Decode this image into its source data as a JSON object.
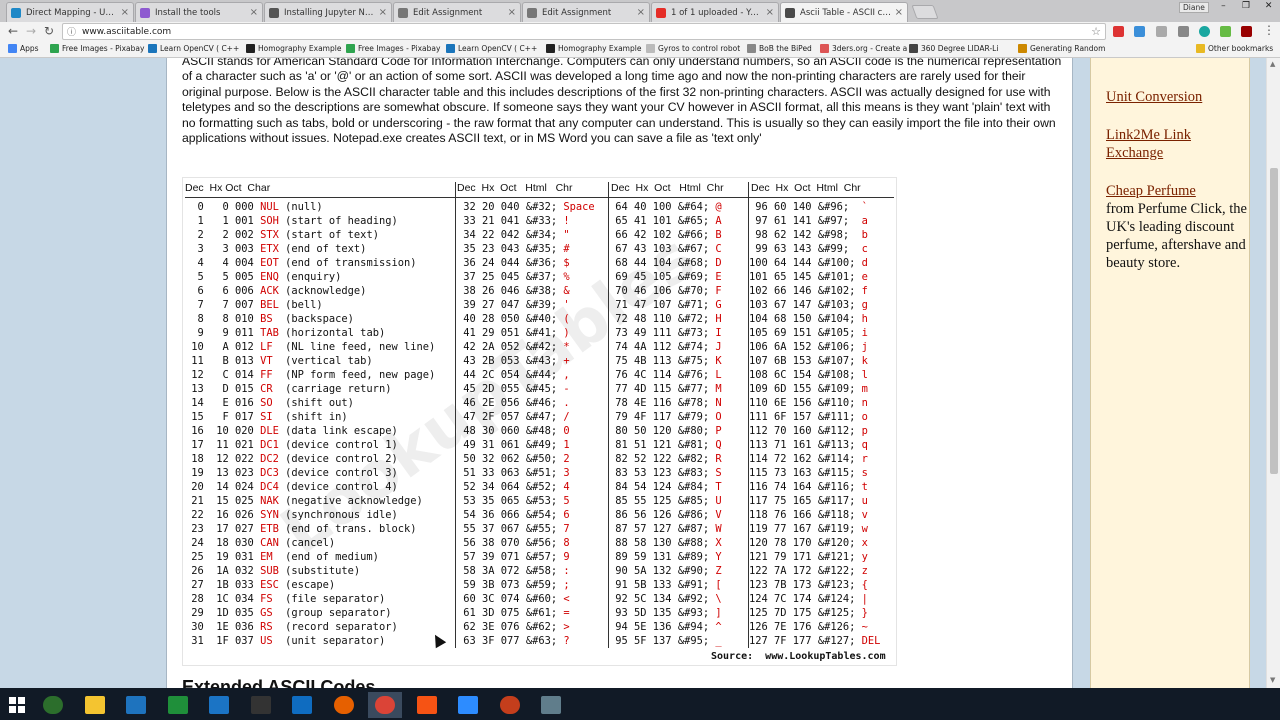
{
  "tabs": [
    {
      "title": "Direct Mapping - Udacity",
      "color": "#1e88c7"
    },
    {
      "title": "Install the tools",
      "color": "#8e5ad0"
    },
    {
      "title": "Installing Jupyter Notebook",
      "color": "#555555"
    },
    {
      "title": "Edit Assignment",
      "color": "#777777"
    },
    {
      "title": "Edit Assignment",
      "color": "#777777"
    },
    {
      "title": "1 of 1 uploaded - YouTube",
      "color": "#e52d27"
    },
    {
      "title": "Ascii Table - ASCII character",
      "color": "#4a4a4a",
      "active": true
    }
  ],
  "user_name": "Diane",
  "url": "www.asciitable.com",
  "bookmarks": [
    "Apps",
    "Free Images - Pixabay",
    "Learn OpenCV ( C++",
    "Homography Example",
    "Free Images - Pixabay",
    "Learn OpenCV ( C++",
    "Homography Example",
    "Gyros to control robot",
    "BoB the BiPed",
    "3ders.org - Create a 3",
    "360 Degree LIDAR-Li",
    "Generating Random",
    "Other bookmarks"
  ],
  "intro_text": "ASCII stands for American Standard Code for Information Interchange. Computers can only understand numbers, so an ASCII code is the numerical representation of a character such as 'a' or '@' or an action of some sort. ASCII was developed a long time ago and now the non-printing characters are rarely used for their original purpose. Below is the ASCII character table and this includes descriptions of the first 32 non-printing characters. ASCII was actually designed for use with teletypes and so the descriptions are somewhat obscure. If someone says they want your CV however in ASCII format, all this means is they want 'plain' text with no formatting such as tabs, bold or underscoring - the raw format that any computer can understand. This is usually so they can easily import the file into their own applications without issues. Notepad.exe creates ASCII text, or in MS Word you can save a file as 'text only'",
  "table": {
    "headers": [
      "Dec  Hx Oct  Char",
      "Dec  Hx  Oct   Html   Chr",
      "Dec  Hx  Oct   Html  Chr",
      "Dec  Hx  Oct  Html  Chr"
    ],
    "col1": [
      [
        "  0   0 000 ",
        "NUL",
        " (null)"
      ],
      [
        "  1   1 001 ",
        "SOH",
        " (start of heading)"
      ],
      [
        "  2   2 002 ",
        "STX",
        " (start of text)"
      ],
      [
        "  3   3 003 ",
        "ETX",
        " (end of text)"
      ],
      [
        "  4   4 004 ",
        "EOT",
        " (end of transmission)"
      ],
      [
        "  5   5 005 ",
        "ENQ",
        " (enquiry)"
      ],
      [
        "  6   6 006 ",
        "ACK",
        " (acknowledge)"
      ],
      [
        "  7   7 007 ",
        "BEL",
        " (bell)"
      ],
      [
        "  8   8 010 ",
        "BS",
        "  (backspace)"
      ],
      [
        "  9   9 011 ",
        "TAB",
        " (horizontal tab)"
      ],
      [
        " 10   A 012 ",
        "LF",
        "  (NL line feed, new line)"
      ],
      [
        " 11   B 013 ",
        "VT",
        "  (vertical tab)"
      ],
      [
        " 12   C 014 ",
        "FF",
        "  (NP form feed, new page)"
      ],
      [
        " 13   D 015 ",
        "CR",
        "  (carriage return)"
      ],
      [
        " 14   E 016 ",
        "SO",
        "  (shift out)"
      ],
      [
        " 15   F 017 ",
        "SI",
        "  (shift in)"
      ],
      [
        " 16  10 020 ",
        "DLE",
        " (data link escape)"
      ],
      [
        " 17  11 021 ",
        "DC1",
        " (device control 1)"
      ],
      [
        " 18  12 022 ",
        "DC2",
        " (device control 2)"
      ],
      [
        " 19  13 023 ",
        "DC3",
        " (device control 3)"
      ],
      [
        " 20  14 024 ",
        "DC4",
        " (device control 4)"
      ],
      [
        " 21  15 025 ",
        "NAK",
        " (negative acknowledge)"
      ],
      [
        " 22  16 026 ",
        "SYN",
        " (synchronous idle)"
      ],
      [
        " 23  17 027 ",
        "ETB",
        " (end of trans. block)"
      ],
      [
        " 24  18 030 ",
        "CAN",
        " (cancel)"
      ],
      [
        " 25  19 031 ",
        "EM",
        "  (end of medium)"
      ],
      [
        " 26  1A 032 ",
        "SUB",
        " (substitute)"
      ],
      [
        " 27  1B 033 ",
        "ESC",
        " (escape)"
      ],
      [
        " 28  1C 034 ",
        "FS",
        "  (file separator)"
      ],
      [
        " 29  1D 035 ",
        "GS",
        "  (group separator)"
      ],
      [
        " 30  1E 036 ",
        "RS",
        "  (record separator)"
      ],
      [
        " 31  1F 037 ",
        "US",
        "  (unit separator)"
      ]
    ],
    "col2": [
      [
        " 32 20 040 &#32; ",
        "Space"
      ],
      [
        " 33 21 041 &#33; ",
        "!"
      ],
      [
        " 34 22 042 &#34; ",
        "\""
      ],
      [
        " 35 23 043 &#35; ",
        "#"
      ],
      [
        " 36 24 044 &#36; ",
        "$"
      ],
      [
        " 37 25 045 &#37; ",
        "%"
      ],
      [
        " 38 26 046 &#38; ",
        "&"
      ],
      [
        " 39 27 047 &#39; ",
        "'"
      ],
      [
        " 40 28 050 &#40; ",
        "("
      ],
      [
        " 41 29 051 &#41; ",
        ")"
      ],
      [
        " 42 2A 052 &#42; ",
        "*"
      ],
      [
        " 43 2B 053 &#43; ",
        "+"
      ],
      [
        " 44 2C 054 &#44; ",
        ","
      ],
      [
        " 45 2D 055 &#45; ",
        "-"
      ],
      [
        " 46 2E 056 &#46; ",
        "."
      ],
      [
        " 47 2F 057 &#47; ",
        "/"
      ],
      [
        " 48 30 060 &#48; ",
        "0"
      ],
      [
        " 49 31 061 &#49; ",
        "1"
      ],
      [
        " 50 32 062 &#50; ",
        "2"
      ],
      [
        " 51 33 063 &#51; ",
        "3"
      ],
      [
        " 52 34 064 &#52; ",
        "4"
      ],
      [
        " 53 35 065 &#53; ",
        "5"
      ],
      [
        " 54 36 066 &#54; ",
        "6"
      ],
      [
        " 55 37 067 &#55; ",
        "7"
      ],
      [
        " 56 38 070 &#56; ",
        "8"
      ],
      [
        " 57 39 071 &#57; ",
        "9"
      ],
      [
        " 58 3A 072 &#58; ",
        ":"
      ],
      [
        " 59 3B 073 &#59; ",
        ";"
      ],
      [
        " 60 3C 074 &#60; ",
        "<"
      ],
      [
        " 61 3D 075 &#61; ",
        "="
      ],
      [
        " 62 3E 076 &#62; ",
        ">"
      ],
      [
        " 63 3F 077 &#63; ",
        "?"
      ]
    ],
    "col3": [
      [
        " 64 40 100 &#64; ",
        "@"
      ],
      [
        " 65 41 101 &#65; ",
        "A"
      ],
      [
        " 66 42 102 &#66; ",
        "B"
      ],
      [
        " 67 43 103 &#67; ",
        "C"
      ],
      [
        " 68 44 104 &#68; ",
        "D"
      ],
      [
        " 69 45 105 &#69; ",
        "E"
      ],
      [
        " 70 46 106 &#70; ",
        "F"
      ],
      [
        " 71 47 107 &#71; ",
        "G"
      ],
      [
        " 72 48 110 &#72; ",
        "H"
      ],
      [
        " 73 49 111 &#73; ",
        "I"
      ],
      [
        " 74 4A 112 &#74; ",
        "J"
      ],
      [
        " 75 4B 113 &#75; ",
        "K"
      ],
      [
        " 76 4C 114 &#76; ",
        "L"
      ],
      [
        " 77 4D 115 &#77; ",
        "M"
      ],
      [
        " 78 4E 116 &#78; ",
        "N"
      ],
      [
        " 79 4F 117 &#79; ",
        "O"
      ],
      [
        " 80 50 120 &#80; ",
        "P"
      ],
      [
        " 81 51 121 &#81; ",
        "Q"
      ],
      [
        " 82 52 122 &#82; ",
        "R"
      ],
      [
        " 83 53 123 &#83; ",
        "S"
      ],
      [
        " 84 54 124 &#84; ",
        "T"
      ],
      [
        " 85 55 125 &#85; ",
        "U"
      ],
      [
        " 86 56 126 &#86; ",
        "V"
      ],
      [
        " 87 57 127 &#87; ",
        "W"
      ],
      [
        " 88 58 130 &#88; ",
        "X"
      ],
      [
        " 89 59 131 &#89; ",
        "Y"
      ],
      [
        " 90 5A 132 &#90; ",
        "Z"
      ],
      [
        " 91 5B 133 &#91; ",
        "["
      ],
      [
        " 92 5C 134 &#92; ",
        "\\"
      ],
      [
        " 93 5D 135 &#93; ",
        "]"
      ],
      [
        " 94 5E 136 &#94; ",
        "^"
      ],
      [
        " 95 5F 137 &#95; ",
        "_"
      ]
    ],
    "col4": [
      [
        " 96 60 140 &#96;  ",
        "`"
      ],
      [
        " 97 61 141 &#97;  ",
        "a"
      ],
      [
        " 98 62 142 &#98;  ",
        "b"
      ],
      [
        " 99 63 143 &#99;  ",
        "c"
      ],
      [
        "100 64 144 &#100; ",
        "d"
      ],
      [
        "101 65 145 &#101; ",
        "e"
      ],
      [
        "102 66 146 &#102; ",
        "f"
      ],
      [
        "103 67 147 &#103; ",
        "g"
      ],
      [
        "104 68 150 &#104; ",
        "h"
      ],
      [
        "105 69 151 &#105; ",
        "i"
      ],
      [
        "106 6A 152 &#106; ",
        "j"
      ],
      [
        "107 6B 153 &#107; ",
        "k"
      ],
      [
        "108 6C 154 &#108; ",
        "l"
      ],
      [
        "109 6D 155 &#109; ",
        "m"
      ],
      [
        "110 6E 156 &#110; ",
        "n"
      ],
      [
        "111 6F 157 &#111; ",
        "o"
      ],
      [
        "112 70 160 &#112; ",
        "p"
      ],
      [
        "113 71 161 &#113; ",
        "q"
      ],
      [
        "114 72 162 &#114; ",
        "r"
      ],
      [
        "115 73 163 &#115; ",
        "s"
      ],
      [
        "116 74 164 &#116; ",
        "t"
      ],
      [
        "117 75 165 &#117; ",
        "u"
      ],
      [
        "118 76 166 &#118; ",
        "v"
      ],
      [
        "119 77 167 &#119; ",
        "w"
      ],
      [
        "120 78 170 &#120; ",
        "x"
      ],
      [
        "121 79 171 &#121; ",
        "y"
      ],
      [
        "122 7A 172 &#122; ",
        "z"
      ],
      [
        "123 7B 173 &#123; ",
        "{"
      ],
      [
        "124 7C 174 &#124; ",
        "|"
      ],
      [
        "125 7D 175 &#125; ",
        "}"
      ],
      [
        "126 7E 176 &#126; ",
        "~"
      ],
      [
        "127 7F 177 &#127; ",
        "DEL"
      ]
    ],
    "source": "Source:  www.LookupTables.com",
    "watermark": "LookupTables"
  },
  "extended_title": "Extended ASCII Codes",
  "sidebar": {
    "link1": "Unit Conversion",
    "link2": "Link2Me Link Exchange",
    "link3": "Cheap Perfume",
    "text3": "from Perfume Click, the UK's leading discount perfume, aftershave and beauty store."
  },
  "colors": {
    "code_red": "#d00000",
    "sidebar_bg": "#fff5dc",
    "link": "#7a2200",
    "page_bg": "#c7d8e6"
  },
  "icons": {
    "taskbar": [
      "windows-start-icon",
      "app-green-icon",
      "file-explorer-icon",
      "computer-icon",
      "excel-icon",
      "edge-icon",
      "terminal-icon",
      "outlook-icon",
      "firefox-icon",
      "chrome-icon",
      "windows-logo-icon",
      "zoom-icon",
      "powerpoint-icon",
      "window-icon"
    ]
  }
}
